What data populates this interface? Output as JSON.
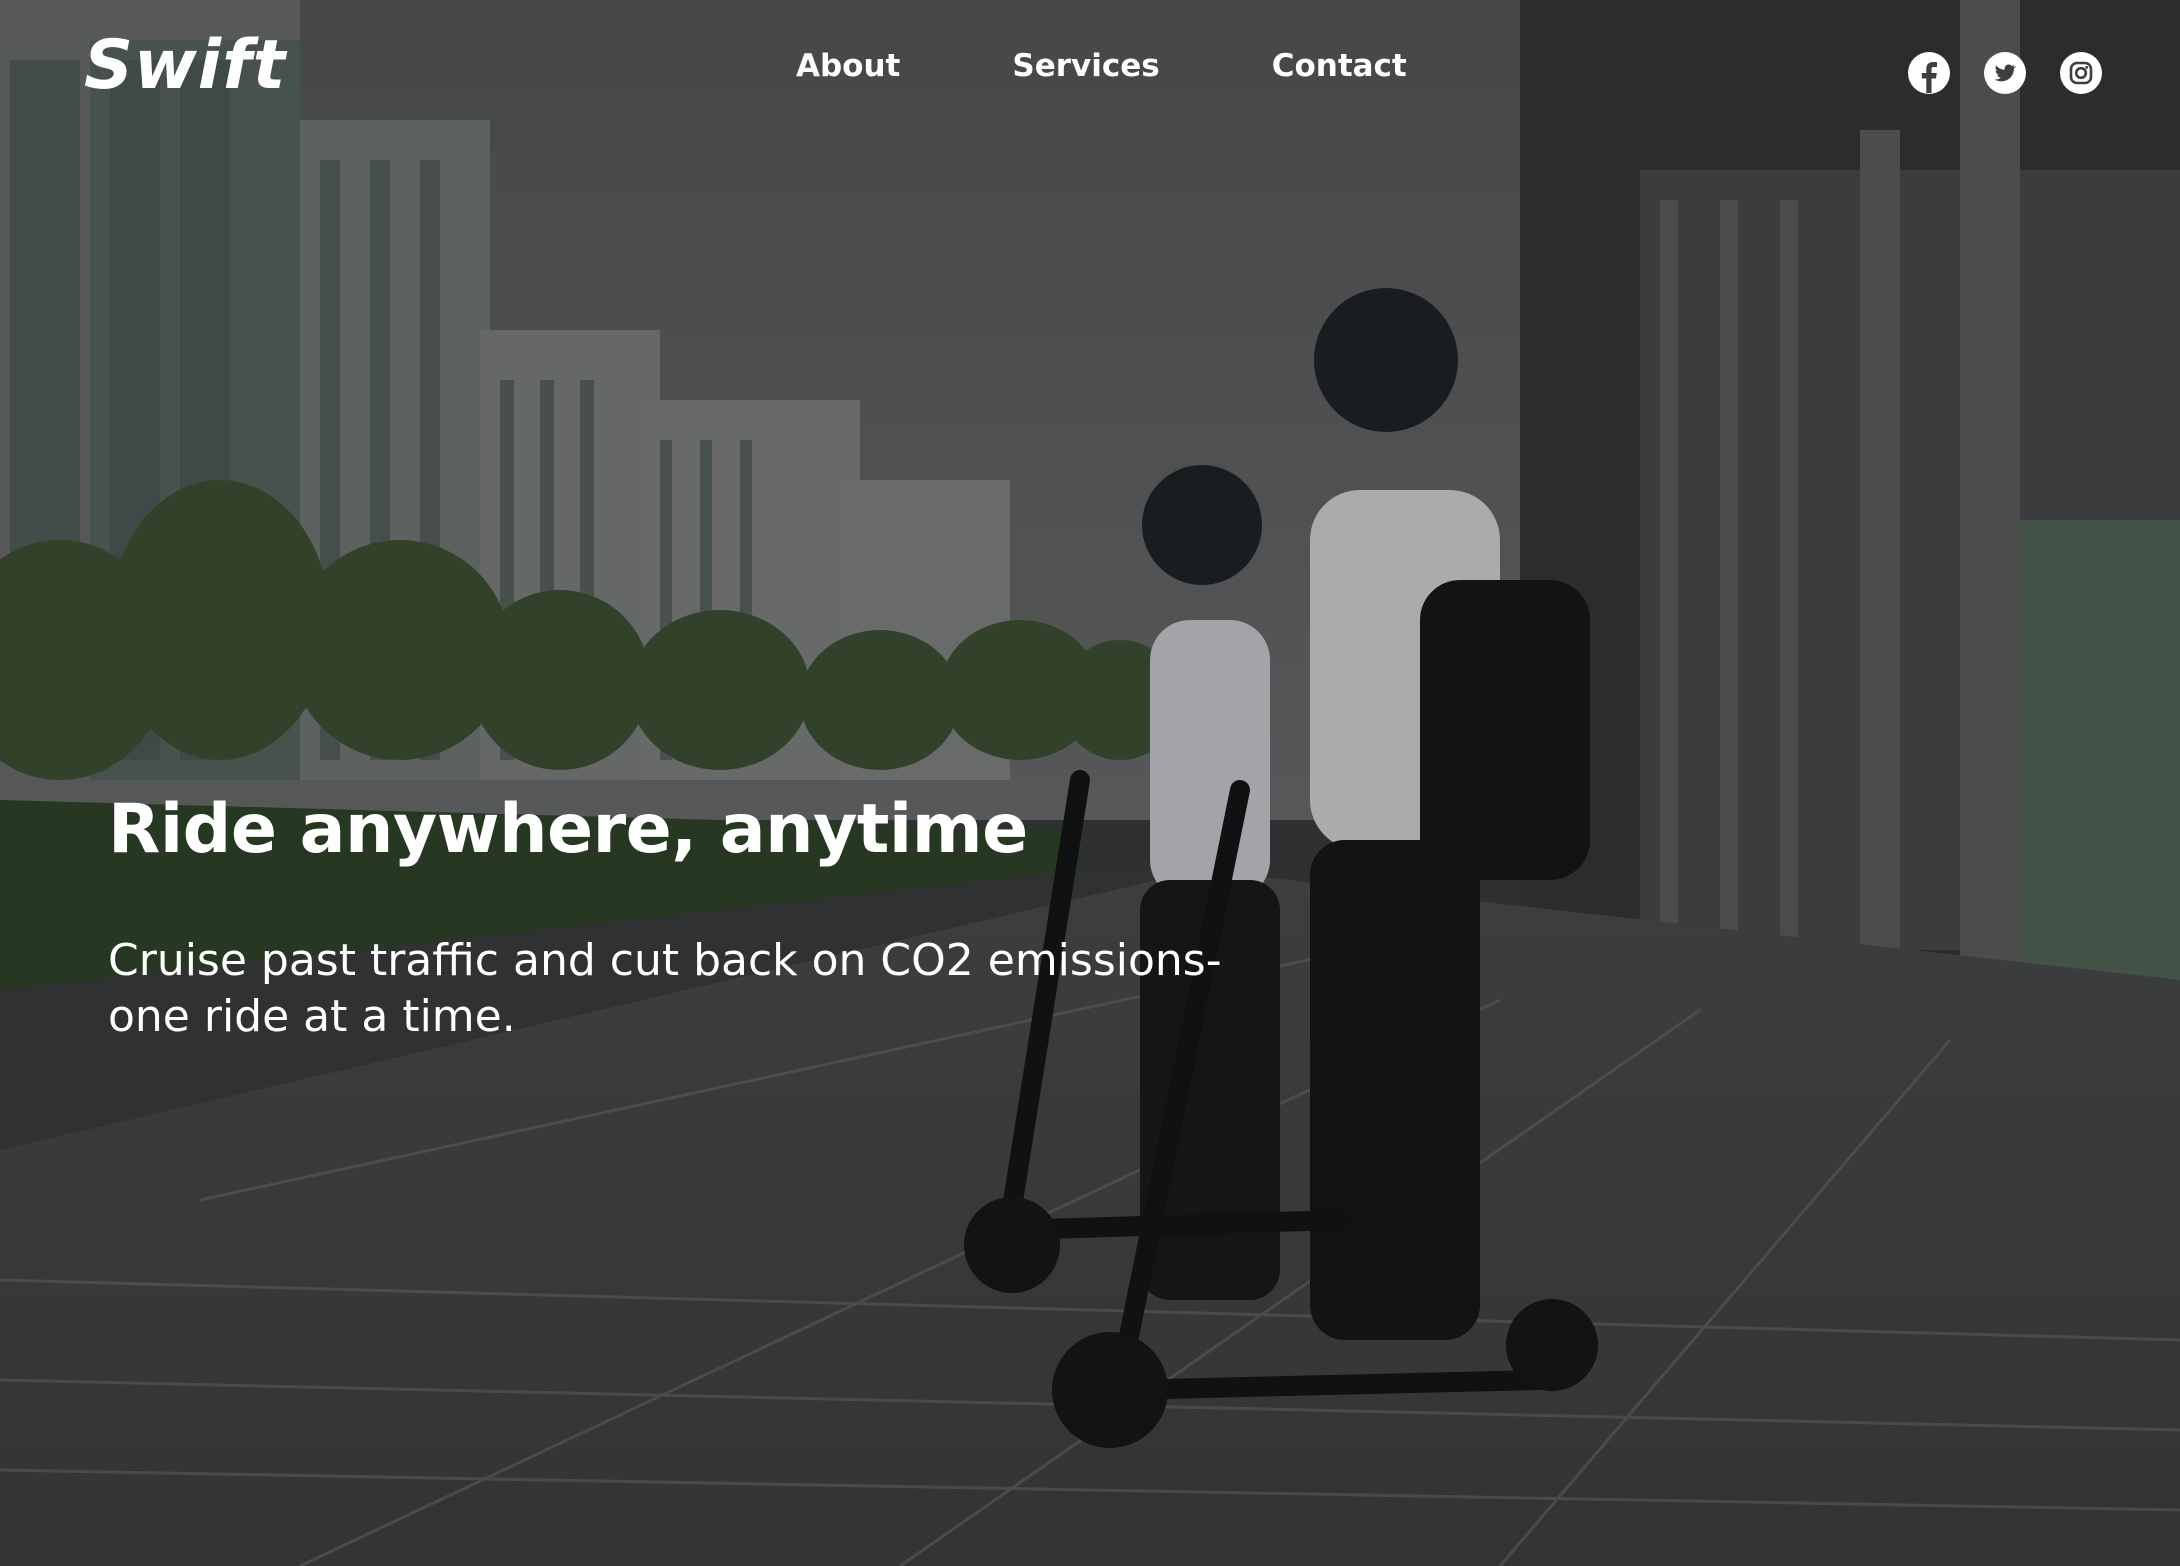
{
  "brand": {
    "logo_text": "Swift"
  },
  "nav": {
    "links": [
      {
        "label": "About"
      },
      {
        "label": "Services"
      },
      {
        "label": "Contact"
      }
    ]
  },
  "socials": [
    {
      "icon": "facebook-icon"
    },
    {
      "icon": "twitter-icon"
    },
    {
      "icon": "instagram-icon"
    }
  ],
  "hero": {
    "headline": "Ride anywhere, anytime",
    "subheadline": "Cruise past traffic and cut back on CO2 emissions- one ride at a time."
  },
  "colors": {
    "text": "#ffffff",
    "overlay": "#141416"
  }
}
